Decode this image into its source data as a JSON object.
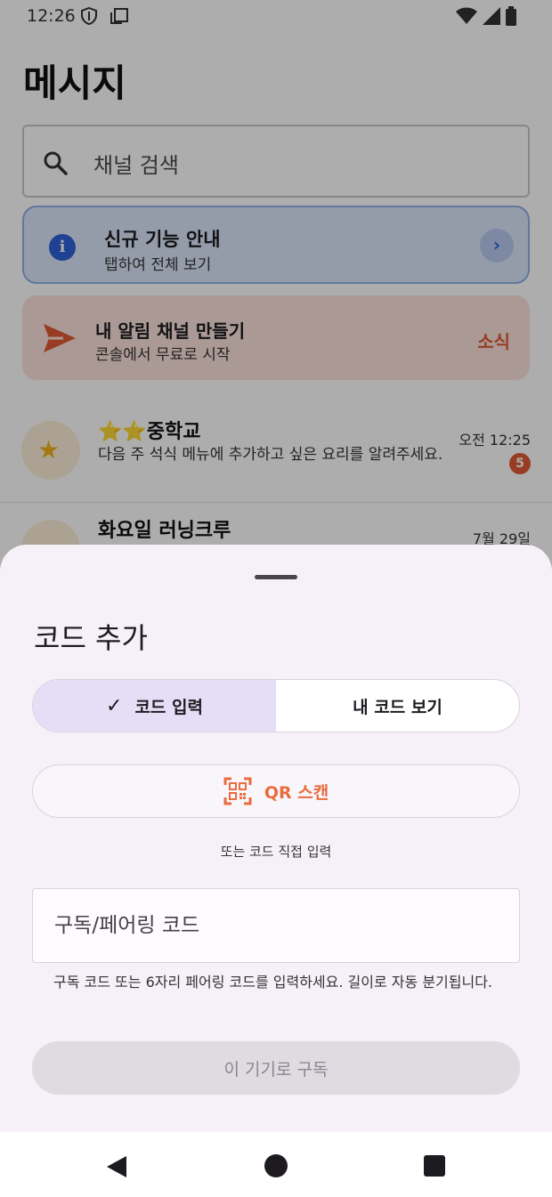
{
  "status": {
    "time": "12:26"
  },
  "page": {
    "title": "메시지"
  },
  "search": {
    "placeholder": "채널 검색"
  },
  "info_card": {
    "title": "신규 기능 안내",
    "subtitle": "탭하여 전체 보기"
  },
  "promo_card": {
    "title": "내 알림 채널 만들기",
    "subtitle": "콘솔에서 무료로 시작",
    "link": "소식"
  },
  "messages": [
    {
      "stars": "⭐⭐",
      "title": "중학교",
      "text": "다음 주 석식 메뉴에 추가하고 싶은 요리를 알려주세요.",
      "time": "오전 12:25",
      "badge": "5"
    },
    {
      "title": "화요일 러닝크루",
      "time": "7월 29일"
    }
  ],
  "sheet": {
    "title": "코드 추가",
    "tabs": [
      {
        "label": "코드 입력",
        "selected": true
      },
      {
        "label": "내 코드 보기",
        "selected": false
      }
    ],
    "qr_button": "QR 스캔",
    "or_text": "또는 코드 직접 입력",
    "code_input": {
      "placeholder": "구독/페어링 코드",
      "value": ""
    },
    "helper": "구독 코드 또는 6자리 페어링 코드를 입력하세요. 길이로 자동 분기됩니다.",
    "submit": "이 기기로 구독"
  },
  "colors": {
    "accent": "#e96c3f",
    "selected_tab": "#e6ddf6",
    "info_blue": "#2f63d8",
    "badge": "#e05a34"
  },
  "icons": [
    "shield-icon",
    "screen-icon",
    "wifi-icon",
    "signal-icon",
    "battery-icon",
    "search-icon",
    "info-icon",
    "chevron-right-icon",
    "send-icon",
    "star-icon",
    "check-icon",
    "qr-scan-icon",
    "back-icon",
    "home-icon",
    "recents-icon"
  ]
}
